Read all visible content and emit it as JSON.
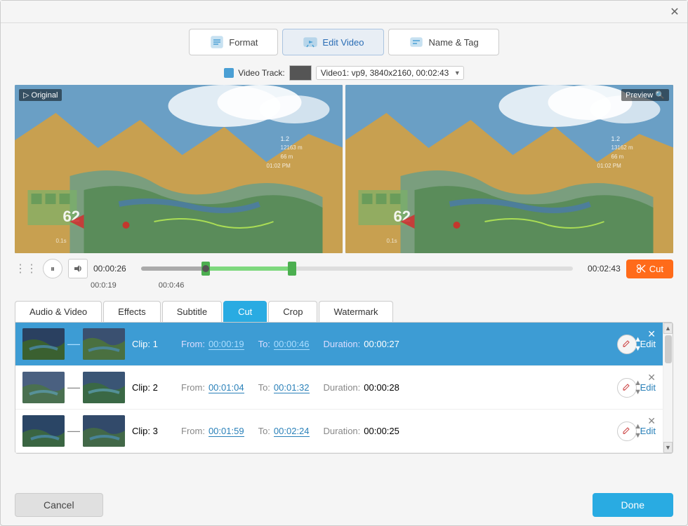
{
  "window": {
    "close_label": "✕"
  },
  "top_nav": {
    "tabs": [
      {
        "id": "format",
        "label": "Format",
        "active": false,
        "icon": "📋"
      },
      {
        "id": "edit_video",
        "label": "Edit Video",
        "active": true,
        "icon": "✂️"
      },
      {
        "id": "name_tag",
        "label": "Name & Tag",
        "active": false,
        "icon": "🏷️"
      }
    ]
  },
  "video_track": {
    "label": "Video Track:",
    "value": "Video1: vp9, 3840x2160, 00:02:43"
  },
  "panels": {
    "original_label": "▷ Original",
    "preview_label": "Preview 🔍"
  },
  "timeline": {
    "current_time": "00:00:26",
    "total_time": "00:02:43",
    "start_time": "00:0:19",
    "end_time": "00:0:46",
    "cut_label": "Cut"
  },
  "edit_tabs": [
    {
      "id": "audio_video",
      "label": "Audio & Video",
      "active": false
    },
    {
      "id": "effects",
      "label": "Effects",
      "active": false
    },
    {
      "id": "subtitle",
      "label": "Subtitle",
      "active": false
    },
    {
      "id": "cut",
      "label": "Cut",
      "active": true
    },
    {
      "id": "crop",
      "label": "Crop",
      "active": false
    },
    {
      "id": "watermark",
      "label": "Watermark",
      "active": false
    }
  ],
  "clips": [
    {
      "id": "clip1",
      "name": "Clip: 1",
      "from_label": "From:",
      "from_time": "00:00:19",
      "to_label": "To:",
      "to_time": "00:00:46",
      "duration_label": "Duration:",
      "duration_time": "00:00:27",
      "edit_label": "Edit",
      "selected": true
    },
    {
      "id": "clip2",
      "name": "Clip: 2",
      "from_label": "From:",
      "from_time": "00:01:04",
      "to_label": "To:",
      "to_time": "00:01:32",
      "duration_label": "Duration:",
      "duration_time": "00:00:28",
      "edit_label": "Edit",
      "selected": false
    },
    {
      "id": "clip3",
      "name": "Clip: 3",
      "from_label": "From:",
      "from_time": "00:01:59",
      "to_label": "To:",
      "to_time": "00:02:24",
      "duration_label": "Duration:",
      "duration_time": "00:00:25",
      "edit_label": "Edit",
      "selected": false
    }
  ],
  "footer": {
    "cancel_label": "Cancel",
    "done_label": "Done"
  }
}
